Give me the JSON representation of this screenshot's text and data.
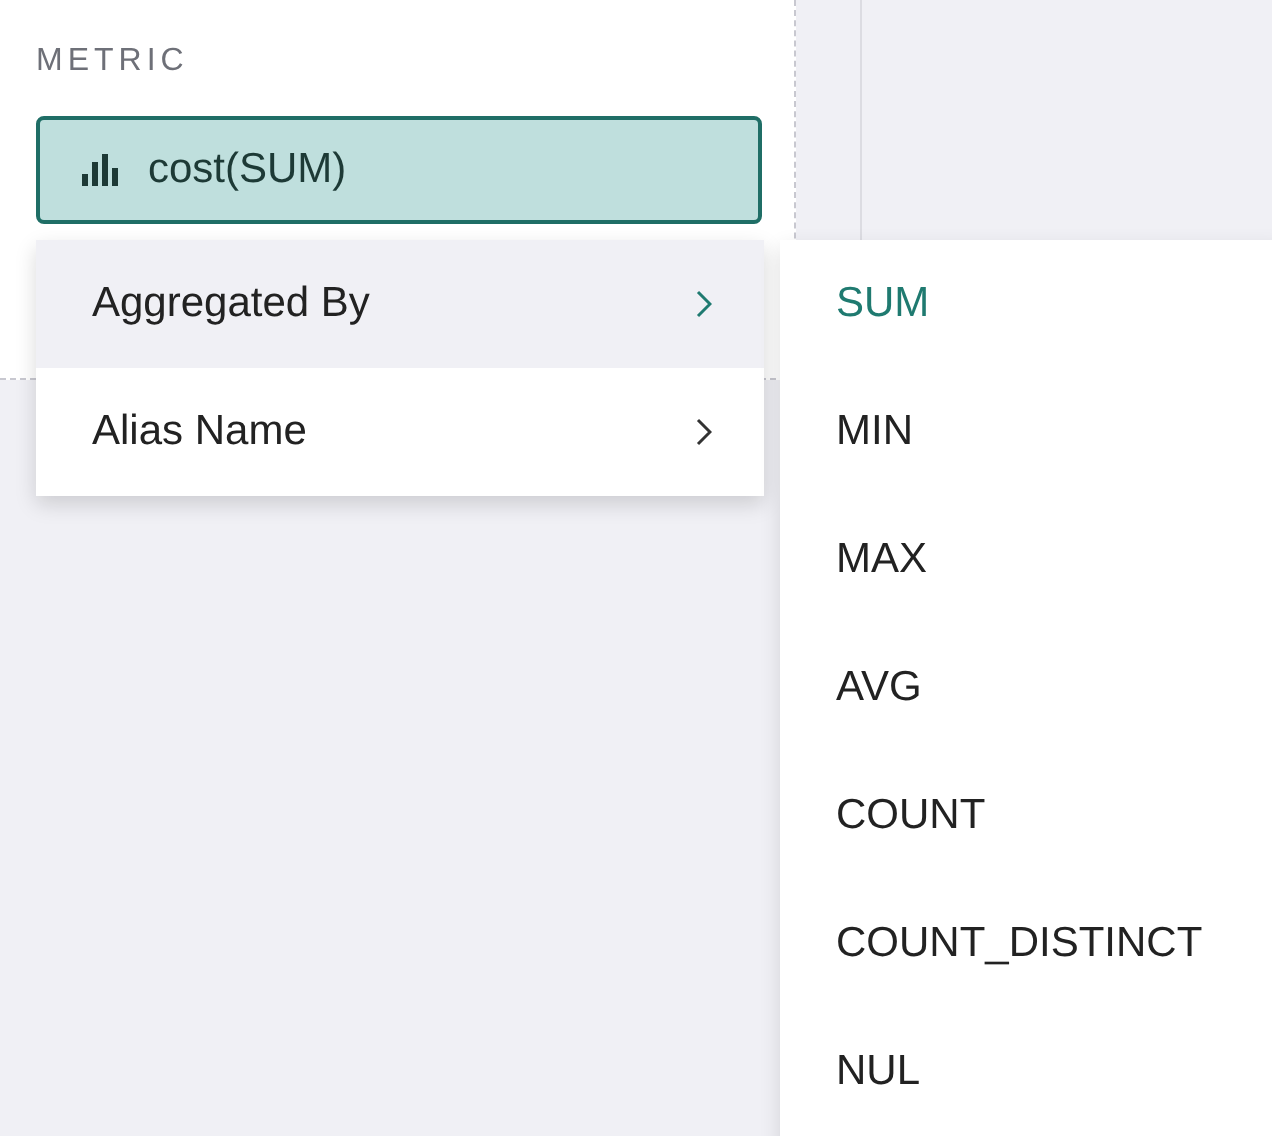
{
  "metric_section": {
    "label": "METRIC",
    "field": {
      "value": "cost(SUM)"
    }
  },
  "context_menu": {
    "items": [
      {
        "label": "Aggregated By",
        "selected": true
      },
      {
        "label": "Alias Name",
        "selected": false
      }
    ]
  },
  "submenu": {
    "items": [
      {
        "label": "SUM",
        "selected": true
      },
      {
        "label": "MIN",
        "selected": false
      },
      {
        "label": "MAX",
        "selected": false
      },
      {
        "label": "AVG",
        "selected": false
      },
      {
        "label": "COUNT",
        "selected": false
      },
      {
        "label": "COUNT_DISTINCT",
        "selected": false
      },
      {
        "label": "NUL",
        "selected": false
      }
    ]
  }
}
